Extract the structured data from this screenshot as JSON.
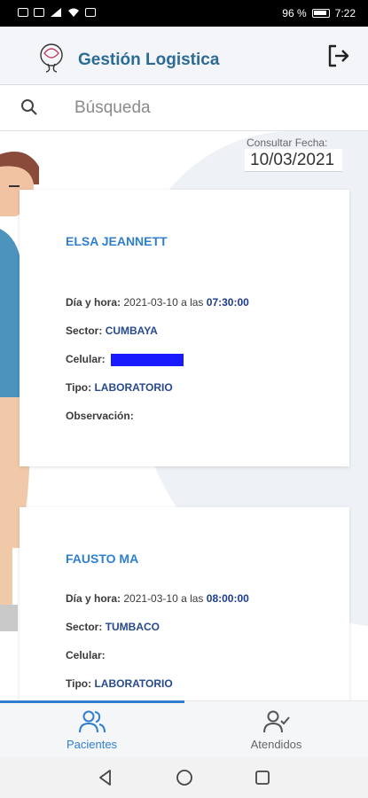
{
  "status_bar": {
    "battery_percent": "96 %",
    "time": "7:22"
  },
  "header": {
    "title": "Gestión Logistica"
  },
  "search": {
    "placeholder": "Búsqueda"
  },
  "date_filter": {
    "label": "Consultar Fecha:",
    "value": "10/03/2021"
  },
  "patients": [
    {
      "name": "ELSA JEANNETT",
      "datetime_label": "Día y hora:",
      "date_text": "2021-03-10 a las",
      "time": "07:30:00",
      "sector_label": "Sector:",
      "sector": "CUMBAYA",
      "phone_label": "Celular:",
      "type_label": "Tipo:",
      "type": "LABORATORIO",
      "observation_label": "Observación:"
    },
    {
      "name": "FAUSTO MA",
      "datetime_label": "Día y hora:",
      "date_text": "2021-03-10 a las",
      "time": "08:00:00",
      "sector_label": "Sector:",
      "sector": "TUMBACO",
      "phone_label": "Celular:",
      "type_label": "Tipo:",
      "type": "LABORATORIO"
    }
  ],
  "bottom_nav": [
    {
      "label": "Pacientes",
      "icon": "users-icon",
      "active": true
    },
    {
      "label": "Atendidos",
      "icon": "user-check-icon",
      "active": false
    }
  ],
  "colors": {
    "accent": "#2f7fd1",
    "title": "#2c6b94",
    "time": "#1b3c92",
    "redaction": "#1a1aff"
  }
}
